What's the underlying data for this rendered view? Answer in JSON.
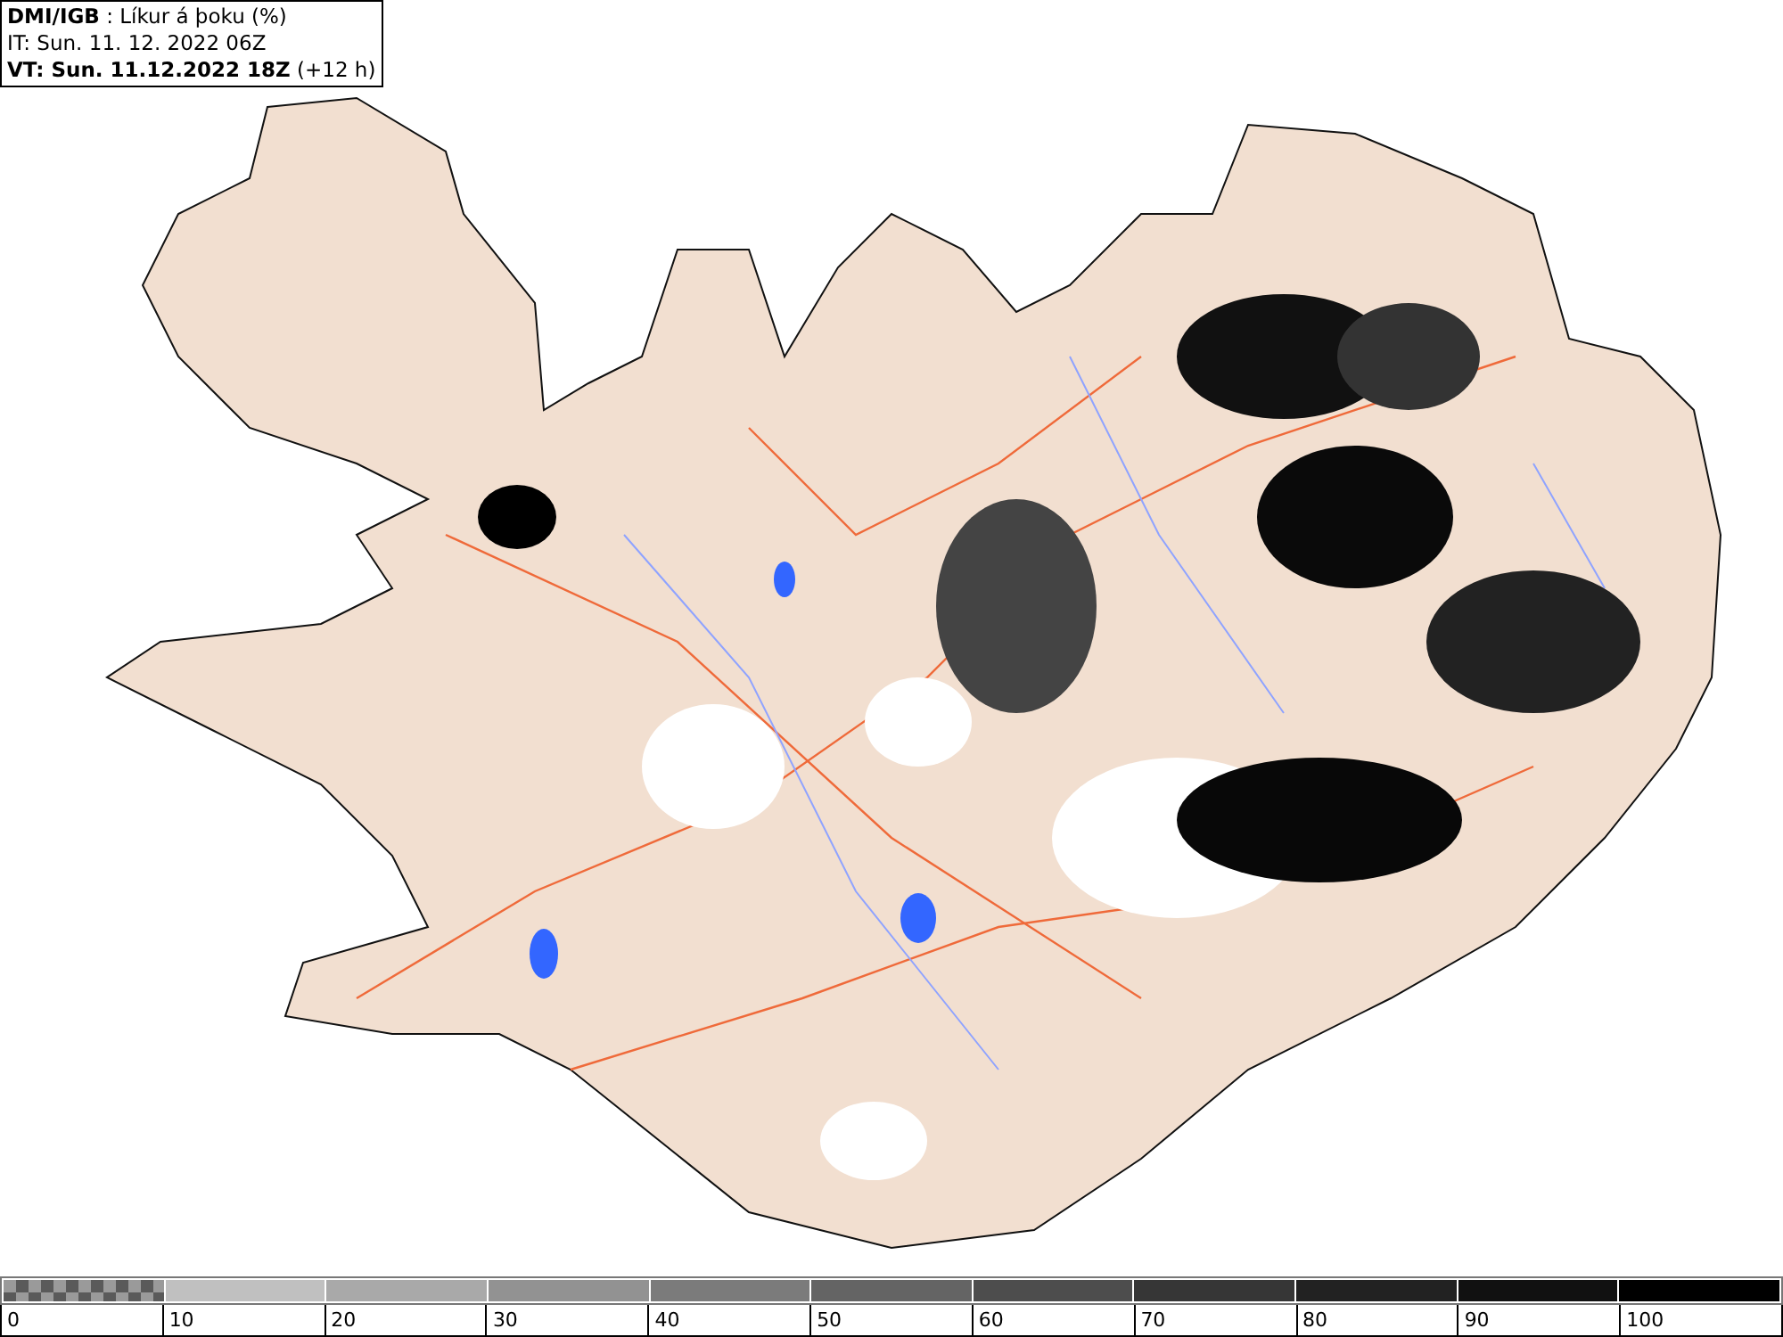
{
  "header": {
    "title": "**DMI/IGB** : Líkur á þoku (%)",
    "issue_time": "IT: Sun. 11. 12. 2022 06Z",
    "valid_time": "**VT: Sun. 11.12.2022 18Z** (+12 h)"
  },
  "legend": {
    "segments": [
      {
        "kind": "pattern",
        "color": "#5a5a5a"
      },
      {
        "kind": "solid",
        "color": "#c0c0c0"
      },
      {
        "kind": "solid",
        "color": "#a9a9a9"
      },
      {
        "kind": "solid",
        "color": "#929292"
      },
      {
        "kind": "solid",
        "color": "#7b7b7b"
      },
      {
        "kind": "solid",
        "color": "#646464"
      },
      {
        "kind": "solid",
        "color": "#4d4d4d"
      },
      {
        "kind": "solid",
        "color": "#363636"
      },
      {
        "kind": "solid",
        "color": "#222222"
      },
      {
        "kind": "solid",
        "color": "#111111"
      },
      {
        "kind": "solid",
        "color": "#000000"
      }
    ],
    "ticks": [
      "0",
      "10",
      "20",
      "30",
      "40",
      "50",
      "60",
      "70",
      "80",
      "90",
      "100"
    ]
  }
}
